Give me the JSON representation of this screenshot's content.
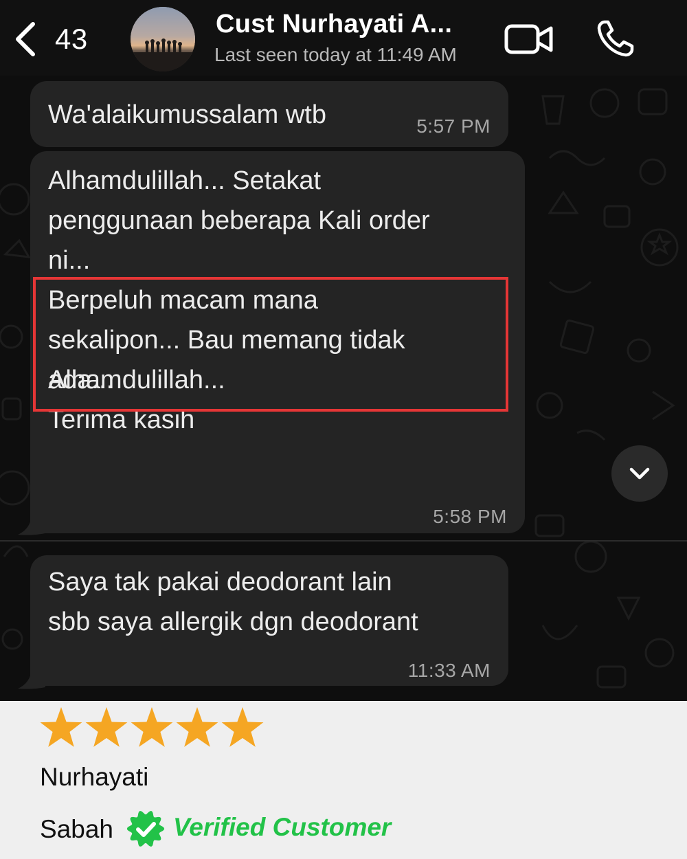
{
  "header": {
    "back_count": "43",
    "contact_name": "Cust Nurhayati A...",
    "contact_status": "Last seen today at 11:49 AM",
    "icons": {
      "back": "chevron-left-icon",
      "video": "video-camera-icon",
      "call": "phone-icon"
    }
  },
  "messages": [
    {
      "text": "Wa'alaikumussalam wtb",
      "time": "5:57 PM"
    },
    {
      "paragraphs": [
        "Alhamdulillah... Setakat\npenggunaan beberapa Kali order\nni...\nBerpeluh macam mana\nsekalipon... Bau memang tidak\nada...",
        "Alhamdulillah...\nTerima kasih"
      ],
      "time": "5:58 PM"
    },
    {
      "text": "Saya tak pakai deodorant lain\nsbb saya allergik dgn deodorant",
      "time": "11:33 AM"
    }
  ],
  "highlight_color": "#e53636",
  "review": {
    "rating": 5,
    "max_rating": 5,
    "star_color": "#f5a623",
    "name": "Nurhayati",
    "location": "Sabah",
    "verified_label": "Verified Customer",
    "verified_color": "#22c248"
  }
}
